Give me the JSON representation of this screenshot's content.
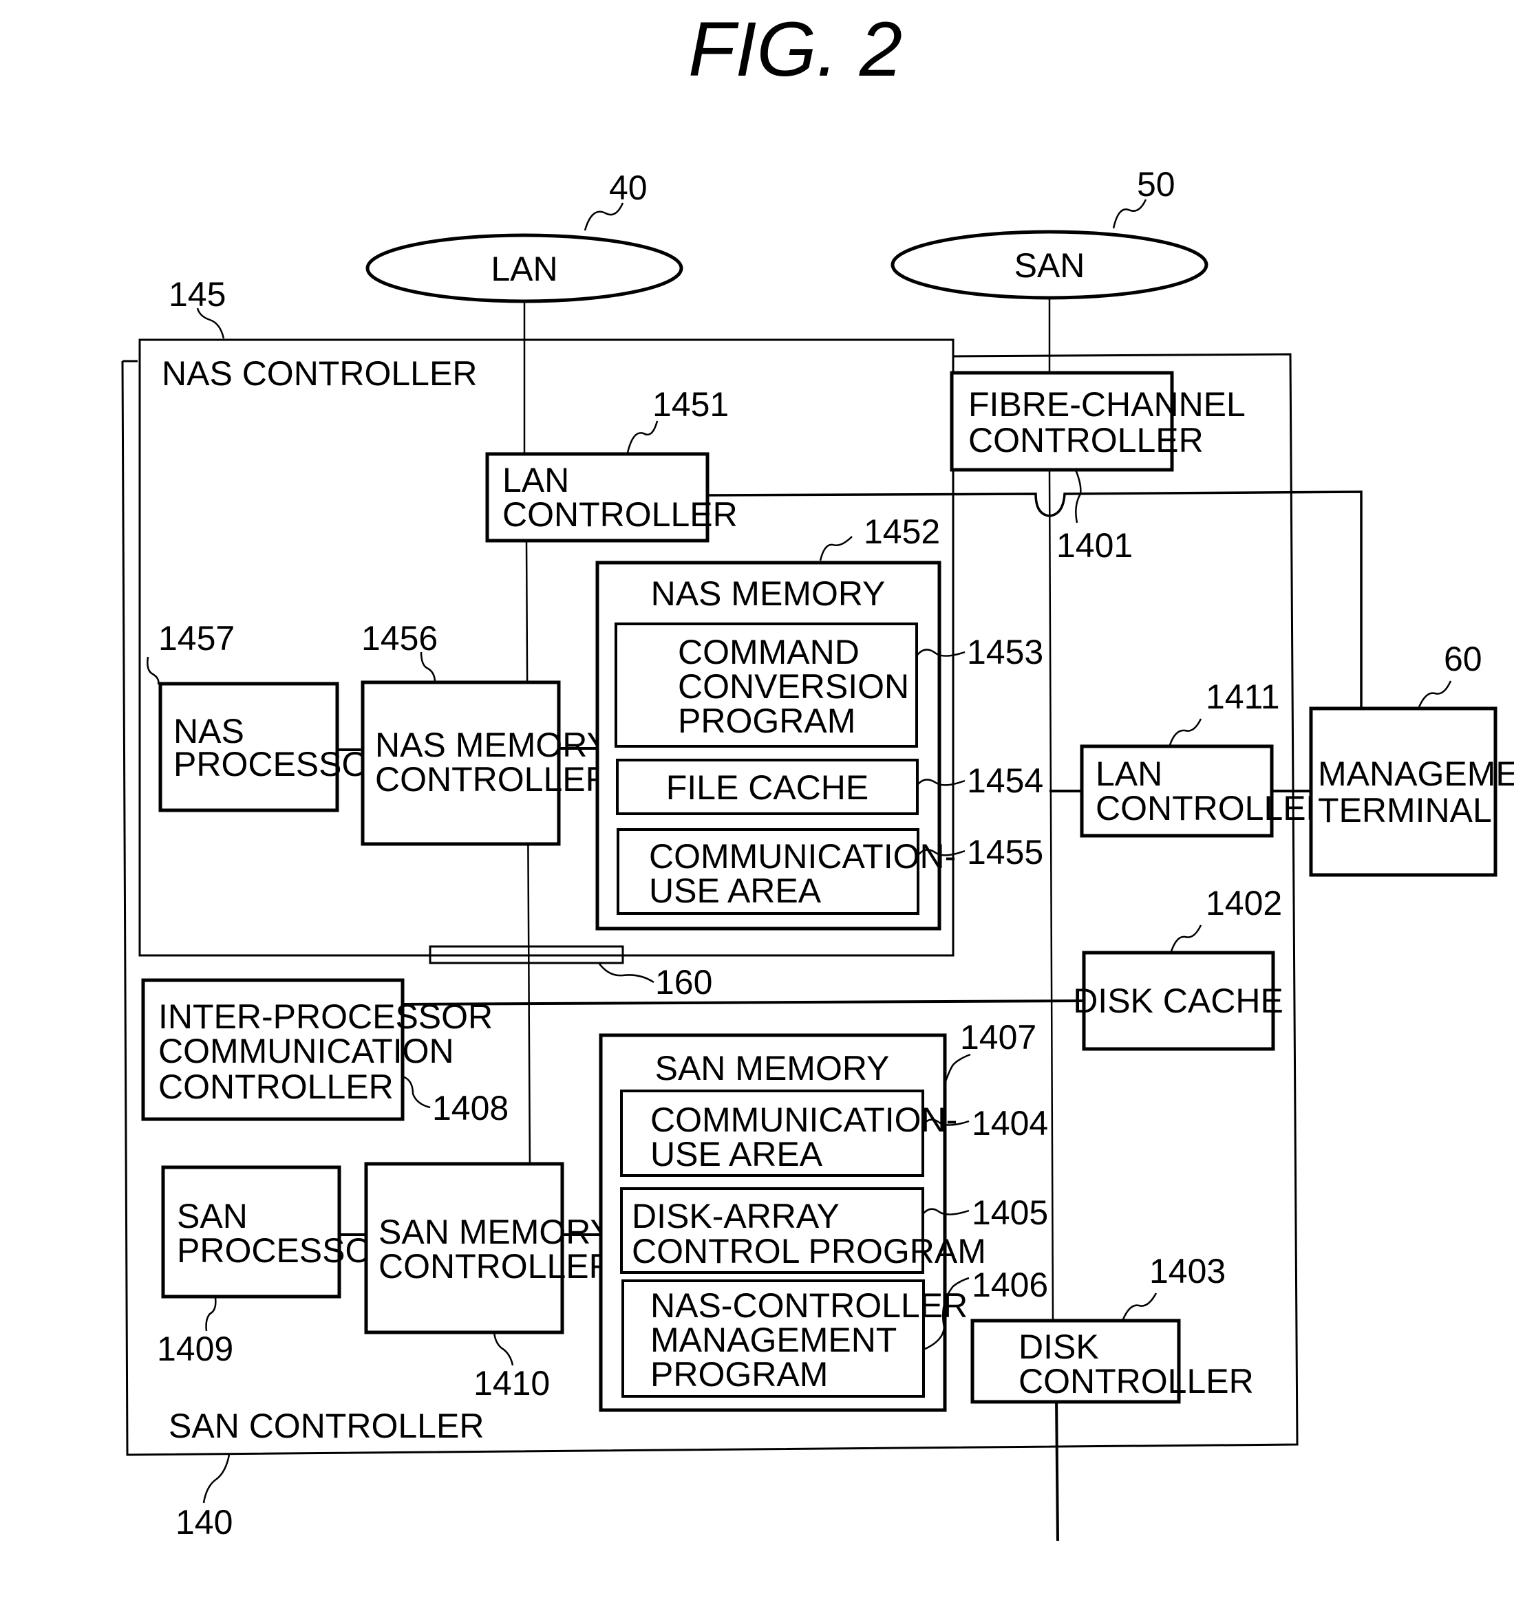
{
  "figure": {
    "title": "FIG.  2"
  },
  "networks": {
    "lan": {
      "label": "LAN",
      "ref": "40"
    },
    "san": {
      "label": "SAN",
      "ref": "50"
    }
  },
  "nas_controller": {
    "label": "NAS  CONTROLLER",
    "ref": "145",
    "lan_controller": {
      "lines": [
        "LAN",
        "CONTROLLER"
      ],
      "ref": "1451"
    },
    "nas_processor": {
      "lines": [
        "NAS",
        "PROCESSOR"
      ],
      "ref": "1457"
    },
    "nas_memory_controller": {
      "lines": [
        "NAS MEMORY",
        "CONTROLLER"
      ],
      "ref": "1456"
    },
    "nas_memory": {
      "label": "NAS  MEMORY",
      "ref": "1452",
      "items": [
        {
          "lines": [
            "COMMAND",
            "CONVERSION",
            "PROGRAM"
          ],
          "ref": "1453"
        },
        {
          "lines": [
            "FILE  CACHE"
          ],
          "ref": "1454"
        },
        {
          "lines": [
            "COMMUNICATION-",
            "USE  AREA"
          ],
          "ref": "1455"
        }
      ]
    }
  },
  "connector": {
    "ref": "160"
  },
  "san_controller": {
    "label": "SAN  CONTROLLER",
    "ref": "140",
    "fibre_channel_controller": {
      "lines": [
        "FIBRE-CHANNEL",
        "CONTROLLER"
      ],
      "ref": "1401"
    },
    "lan_controller": {
      "lines": [
        "LAN",
        "CONTROLLER"
      ],
      "ref": "1411"
    },
    "disk_cache": {
      "lines": [
        "DISK  CACHE"
      ],
      "ref": "1402"
    },
    "disk_controller": {
      "lines": [
        "DISK",
        "CONTROLLER"
      ],
      "ref": "1403"
    },
    "inter_processor_comm_controller": {
      "lines": [
        "INTER-PROCESSOR",
        "COMMUNICATION",
        "CONTROLLER"
      ],
      "ref": "1408"
    },
    "san_processor": {
      "lines": [
        "SAN",
        "PROCESSOR"
      ],
      "ref": "1409"
    },
    "san_memory_controller": {
      "lines": [
        "SAN MEMORY",
        "CONTROLLER"
      ],
      "ref": "1410"
    },
    "san_memory": {
      "label": "SAN  MEMORY",
      "ref": "1407",
      "items": [
        {
          "lines": [
            "COMMUNICATION-",
            "USE  AREA"
          ],
          "ref": "1404"
        },
        {
          "lines": [
            "DISK-ARRAY",
            "CONTROL  PROGRAM"
          ],
          "ref": "1405"
        },
        {
          "lines": [
            "NAS-CONTROLLER",
            "MANAGEMENT",
            "PROGRAM"
          ],
          "ref": "1406"
        }
      ]
    }
  },
  "management_terminal": {
    "lines": [
      "MANAGEMENT",
      "TERMINAL"
    ],
    "ref": "60"
  }
}
